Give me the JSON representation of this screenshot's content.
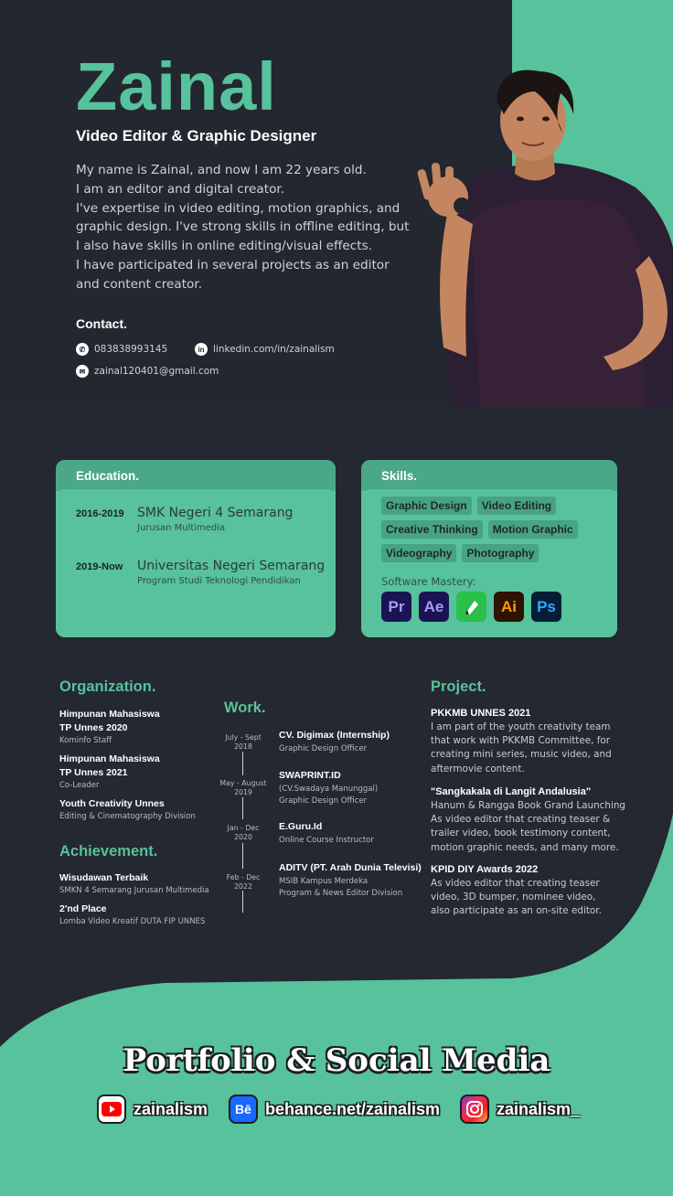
{
  "hero": {
    "name": "Zainal",
    "role": "Video Editor & Graphic Designer",
    "bio": "My name is Zainal, and now I am 22 years old.\nI am an editor and digital creator.\nI've expertise in video editing, motion graphics, and graphic design. I've strong skills in offline editing, but I also have skills  in online editing/visual effects.\nI have participated in several projects as an editor and content creator.",
    "contact_title": "Contact.",
    "phone": "083838993145",
    "linkedin": "linkedin.com/in/zainalism",
    "email": "zainal120401@gmail.com",
    "icons": [
      "whatsapp-icon",
      "linkedin-icon",
      "mail-icon"
    ]
  },
  "education": {
    "title": "Education.",
    "items": [
      {
        "years": "2016-2019",
        "school": "SMK Negeri 4 Semarang",
        "program": "Jurusan Multimedia"
      },
      {
        "years": "2019-Now",
        "school": "Universitas Negeri Semarang",
        "program": "Program Studi Teknologi Pendidikan"
      }
    ]
  },
  "skills": {
    "title": "Skills.",
    "tags": [
      "Graphic Design",
      "Video Editing",
      "Creative Thinking",
      "Motion Graphic",
      "Videography",
      "Photography"
    ],
    "software_title": "Software Mastery:",
    "software": [
      {
        "label": "Pr",
        "bg": "#1b1454",
        "fg": "#a89bff"
      },
      {
        "label": "Ae",
        "bg": "#1b1454",
        "fg": "#a89bff"
      },
      {
        "label": "",
        "bg": "#2bbf4b",
        "fg": "#ffffff"
      },
      {
        "label": "Ai",
        "bg": "#2e1300",
        "fg": "#ff9a00"
      },
      {
        "label": "Ps",
        "bg": "#061e35",
        "fg": "#31a8ff"
      }
    ]
  },
  "organization": {
    "title": "Organization.",
    "items": [
      {
        "name": "Himpunan Mahasiswa\nTP Unnes 2020",
        "sub": "Kominfo Staff"
      },
      {
        "name": "Himpunan Mahasiswa\nTP Unnes 2021",
        "sub": "Co-Leader"
      },
      {
        "name": "Youth Creativity Unnes",
        "sub": "Editing & Cinematography Division"
      }
    ]
  },
  "achievement": {
    "title": "Achievement.",
    "items": [
      {
        "name": "Wisudawan Terbaik",
        "sub": "SMKN 4 Semarang Jurusan Multimedia"
      },
      {
        "name": "2'nd Place",
        "sub": "Lomba Video Kreatif DUTA FIP UNNES"
      }
    ]
  },
  "work": {
    "title": "Work.",
    "items": [
      {
        "date": "July - Sept\n2018",
        "name": "CV. Digimax (Internship)",
        "sub": "Graphic Design Officer"
      },
      {
        "date": "May - August\n2019",
        "name": "SWAPRINT.ID",
        "sub": "(CV.Swadaya Manunggal)\nGraphic Design Officer"
      },
      {
        "date": "Jan - Dec\n2020",
        "name": "E.Guru.Id",
        "sub": "Online Course Instructor"
      },
      {
        "date": "Feb - Dec\n2022",
        "name": "ADITV (PT. Arah Dunia Televisi)",
        "sub": "MSIB Kampus Merdeka\nProgram & News Editor Division"
      }
    ]
  },
  "project": {
    "title": "Project.",
    "items": [
      {
        "name": "PKKMB UNNES 2021",
        "desc": "I am part of the youth creativity team\nthat work with PKKMB Committee, for\ncreating mini series, music video, and\naftermovie content."
      },
      {
        "name": "\"Sangkakala di Langit Andalusia\"",
        "desc": "Hanum & Rangga Book Grand Launching\nAs video editor that creating teaser &\ntrailer video, book testimony content,\nmotion graphic needs, and many more."
      },
      {
        "name": "KPID DIY Awards 2022",
        "desc": "As video editor that creating teaser\nvideo, 3D bumper, nominee video,\nalso participate as an on-site editor."
      }
    ]
  },
  "footer": {
    "title": "Portfolio & Social Media",
    "youtube": "zainalism",
    "behance": "behance.net/zainalism",
    "instagram": "zainalism_",
    "behance_glyph": "Bē",
    "icons": [
      "youtube-icon",
      "behance-icon",
      "instagram-icon"
    ]
  },
  "colors": {
    "accent": "#57c29b",
    "background": "#242831"
  }
}
